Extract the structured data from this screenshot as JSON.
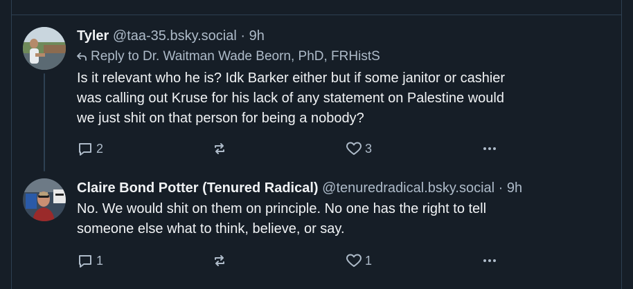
{
  "colors": {
    "background": "#161e27",
    "border": "#2e4052",
    "text": "#f1f3f5",
    "muted": "#aebbc9"
  },
  "posts": [
    {
      "author": "Tyler",
      "handle": "@taa-35.bsky.social",
      "dot": "·",
      "time": "9h",
      "reply_to": "Reply to Dr. Waitman Wade Beorn, PhD, FRHistS",
      "text": "Is it relevant who he is? Idk Barker either but if some janitor or cashier\nwas calling out Kruse for his lack of any statement on Palestine would\nwe just shit on that person for being a nobody?",
      "replies": "2",
      "reposts": "",
      "likes": "3",
      "icons": {
        "reply": "reply-bubble-icon",
        "repost": "repost-icon",
        "like": "heart-icon",
        "more": "more-dots-icon",
        "reply_arrow": "reply-arrow-icon"
      }
    },
    {
      "author": "Claire Bond Potter (Tenured Radical)",
      "handle": "@tenuredradical.bsky.social",
      "dot": "·",
      "time": "9h",
      "text": "No. We would shit on them on principle. No one has the right to tell\nsomeone else what to think, believe, or say.",
      "replies": "1",
      "reposts": "",
      "likes": "1",
      "icons": {
        "reply": "reply-bubble-icon",
        "repost": "repost-icon",
        "like": "heart-icon",
        "more": "more-dots-icon"
      }
    }
  ]
}
